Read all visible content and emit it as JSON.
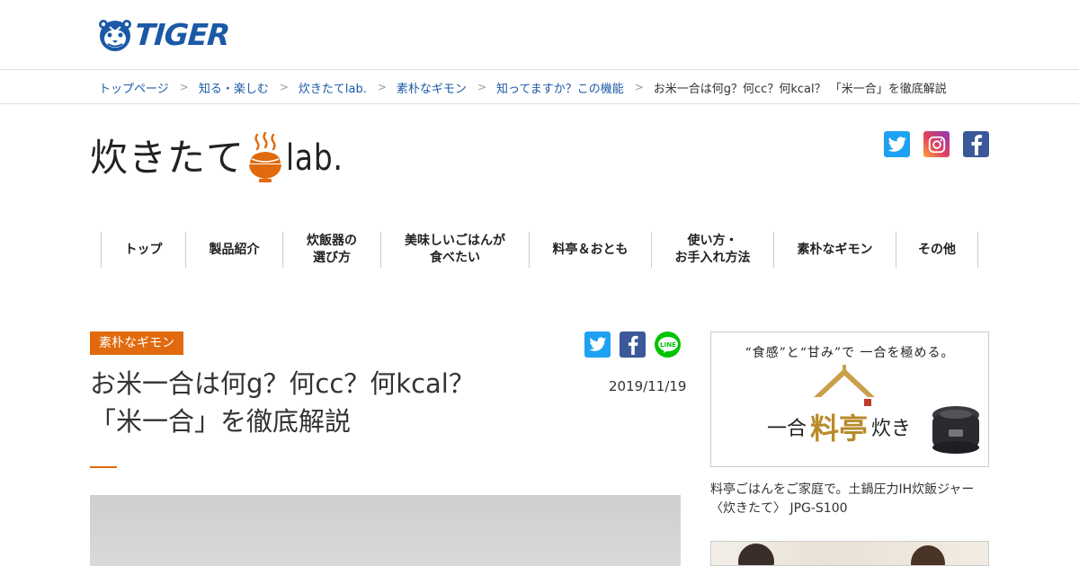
{
  "header": {
    "logo_text": "TIGER"
  },
  "breadcrumb": {
    "items": [
      "トップページ",
      "知る・楽しむ",
      "炊きたてlab.",
      "素朴なギモン",
      "知ってますか？この機能"
    ],
    "separator": ">",
    "current": "お米一合は何g？何cc？何kcal？ 「米一合」を徹底解説"
  },
  "brand": {
    "title_jp": "炊きたて",
    "title_lab": "lab."
  },
  "header_social": [
    "twitter-icon",
    "instagram-icon",
    "facebook-icon"
  ],
  "nav": {
    "items": [
      {
        "line1": "トップ",
        "line2": ""
      },
      {
        "line1": "製品紹介",
        "line2": ""
      },
      {
        "line1": "炊飯器の",
        "line2": "選び方"
      },
      {
        "line1": "美味しいごはんが",
        "line2": "食べたい"
      },
      {
        "line1": "料亭＆おとも",
        "line2": ""
      },
      {
        "line1": "使い方・",
        "line2": "お手入れ方法"
      },
      {
        "line1": "素朴なギモン",
        "line2": ""
      },
      {
        "line1": "その他",
        "line2": ""
      }
    ]
  },
  "article": {
    "category": "素朴なギモン",
    "title_line1": "お米一合は何g？何cc？何kcal？",
    "title_line2": "「米一合」を徹底解説",
    "date": "2019/11/19",
    "share_icons": [
      "twitter-icon",
      "facebook-icon",
      "line-icon"
    ]
  },
  "sidebar": {
    "ad_catch": "“食感”と“甘み”で 一合を極める。",
    "ad_name_left": "一合",
    "ad_name_gold": "料亭",
    "ad_name_right": "炊き",
    "caption": "料亭ごはんをご家庭で。土鍋圧力IH炊飯ジャー〈炊きたて〉 JPG-S100"
  },
  "colors": {
    "brand_blue": "#1b59a6",
    "accent_orange": "#e06a0d",
    "twitter": "#1da1f2",
    "facebook": "#3b5998",
    "line": "#00c300"
  }
}
